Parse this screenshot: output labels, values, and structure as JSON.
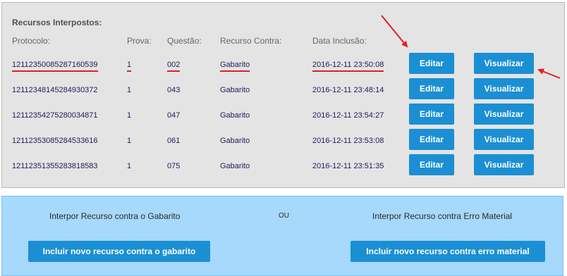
{
  "recursos": {
    "title": "Recursos Interpostos:",
    "columns": [
      "Protocolo:",
      "Prova:",
      "Questão:",
      "Recurso Contra:",
      "Data Inclusão:"
    ],
    "edit_label": "Editar",
    "view_label": "Visualizar",
    "rows": [
      {
        "protocolo": "12112350085287160539",
        "prova": "1",
        "questao": "002",
        "recurso_contra": "Gabarito",
        "data": "2016-12-11 23:50:08"
      },
      {
        "protocolo": "12112348145284930372",
        "prova": "1",
        "questao": "043",
        "recurso_contra": "Gabarito",
        "data": "2016-12-11 23:48:14"
      },
      {
        "protocolo": "12112354275280034871",
        "prova": "1",
        "questao": "047",
        "recurso_contra": "Gabarito",
        "data": "2016-12-11 23:54:27"
      },
      {
        "protocolo": "12112353085284533616",
        "prova": "1",
        "questao": "061",
        "recurso_contra": "Gabarito",
        "data": "2016-12-11 23:53:08"
      },
      {
        "protocolo": "12112351355283818583",
        "prova": "1",
        "questao": "075",
        "recurso_contra": "Gabarito",
        "data": "2016-12-11 23:51:35"
      }
    ]
  },
  "incluir": {
    "gabarito_text": "Interpor Recurso contra o Gabarito",
    "ou_text": "OU",
    "erro_text": "Interpor Recurso contra Erro Material",
    "gabarito_button": "Incluir novo recurso contra o gabarito",
    "erro_button": "Incluir novo recurso contra erro material"
  },
  "colors": {
    "button_blue": "#1b8fd3",
    "panel_gray": "#e4e4e4",
    "panel_blue": "#a6d9fb",
    "annotation_red": "#e31e24"
  }
}
